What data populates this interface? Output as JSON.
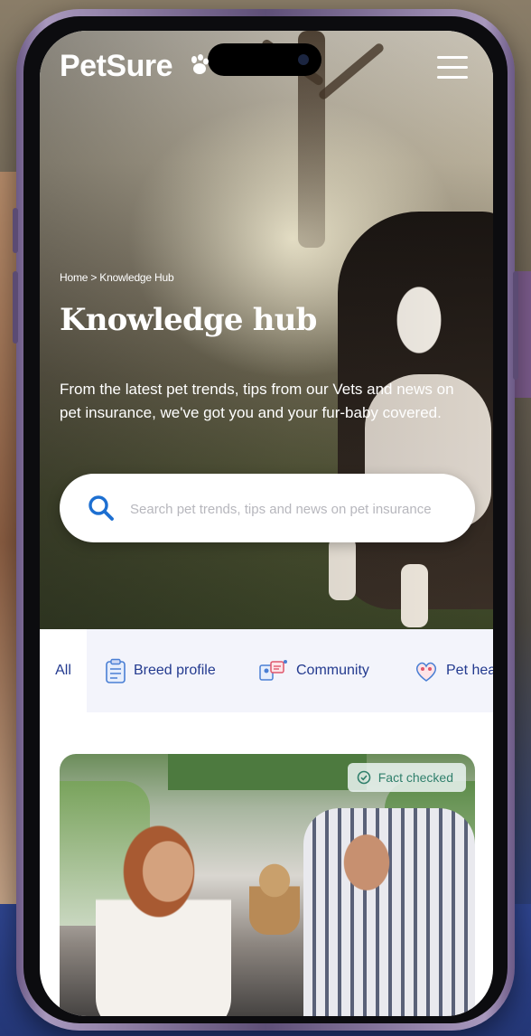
{
  "brand": {
    "logo_text": "PetSure"
  },
  "breadcrumb": {
    "home": "Home",
    "separator": " > ",
    "current": "Knowledge Hub"
  },
  "hero": {
    "title": "Knowledge hub",
    "subtitle": "From the latest pet trends, tips from our Vets and news on pet insurance, we've got you and your fur-baby covered."
  },
  "search": {
    "placeholder": "Search pet trends, tips and news on pet insurance"
  },
  "tabs": [
    {
      "label": "All",
      "icon": "none"
    },
    {
      "label": "Breed profile",
      "icon": "clipboard-icon"
    },
    {
      "label": "Community",
      "icon": "community-icon"
    },
    {
      "label": "Pet health",
      "icon": "pet-health-icon"
    }
  ],
  "card": {
    "badge": "Fact checked",
    "badge_icon": "check-circle-icon"
  },
  "colors": {
    "primary": "#233a8f",
    "accent": "#1d6fd1",
    "badge_text": "#2f7f6b"
  }
}
